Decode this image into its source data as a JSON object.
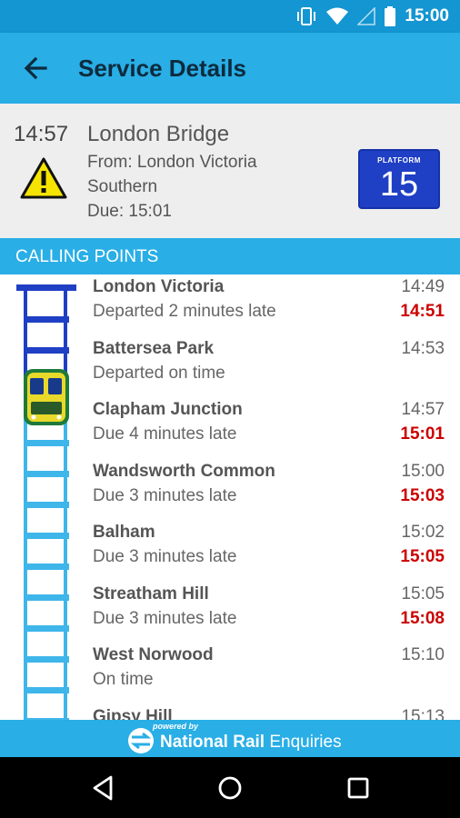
{
  "status_bar": {
    "time": "15:00",
    "icons": [
      "vibrate-icon",
      "wifi-icon",
      "signal-icon",
      "battery-icon"
    ]
  },
  "app_bar": {
    "title": "Service Details"
  },
  "service": {
    "time": "14:57",
    "destination": "London Bridge",
    "from": "From: London Victoria",
    "operator": "Southern",
    "due": "Due: 15:01",
    "platform_label": "PLATFORM",
    "platform_number": "15"
  },
  "section": {
    "title": "CALLING POINTS"
  },
  "calling_points": [
    {
      "name": "London Victoria",
      "status": "Departed 2 minutes late",
      "scheduled": "14:49",
      "actual": "14:51"
    },
    {
      "name": "Battersea Park",
      "status": "Departed on time",
      "scheduled": "14:53",
      "actual": ""
    },
    {
      "name": "Clapham Junction",
      "status": "Due 4 minutes late",
      "scheduled": "14:57",
      "actual": "15:01"
    },
    {
      "name": "Wandsworth Common",
      "status": "Due 3 minutes late",
      "scheduled": "15:00",
      "actual": "15:03"
    },
    {
      "name": "Balham",
      "status": "Due 3 minutes late",
      "scheduled": "15:02",
      "actual": "15:05"
    },
    {
      "name": "Streatham Hill",
      "status": "Due 3 minutes late",
      "scheduled": "15:05",
      "actual": "15:08"
    },
    {
      "name": "West Norwood",
      "status": "On time",
      "scheduled": "15:10",
      "actual": ""
    },
    {
      "name": "Gipsy Hill",
      "status": "",
      "scheduled": "15:13",
      "actual": ""
    }
  ],
  "footer": {
    "powered": "powered by",
    "brand_bold": "National Rail",
    "brand_rest": " Enquiries"
  },
  "colors": {
    "accent": "#29aee6",
    "late": "#cc0000",
    "platform": "#1f3fc4",
    "track_done": "#1f3fc4",
    "track_todo": "#3fb6ea"
  }
}
